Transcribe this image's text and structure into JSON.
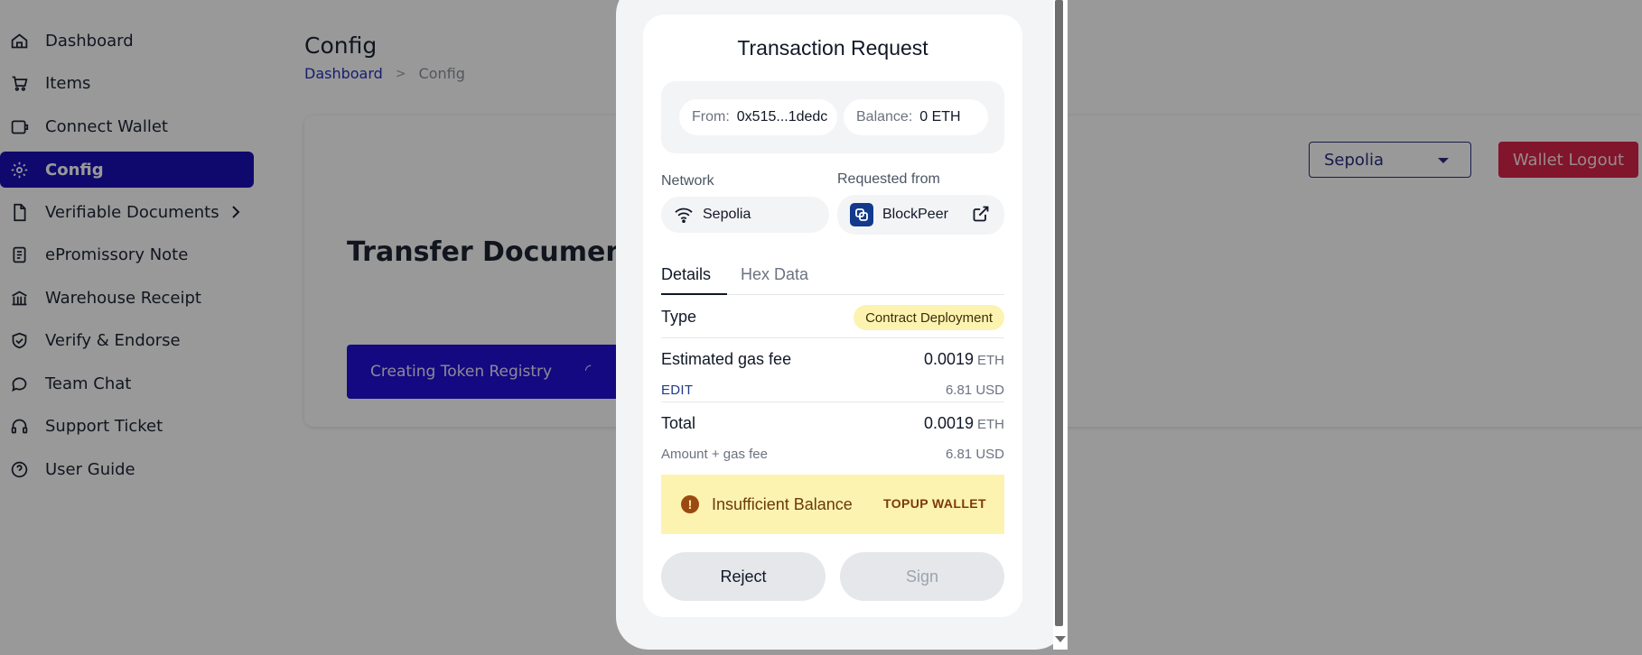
{
  "sidebar": {
    "items": [
      {
        "label": "Dashboard",
        "icon": "home-icon"
      },
      {
        "label": "Items",
        "icon": "cart-icon"
      },
      {
        "label": "Connect Wallet",
        "icon": "wallet-icon"
      },
      {
        "label": "Config",
        "icon": "gear-icon",
        "active": true
      },
      {
        "label": "Verifiable Documents",
        "icon": "document-icon"
      },
      {
        "label": "ePromissory Note",
        "icon": "note-icon"
      },
      {
        "label": "Warehouse Receipt",
        "icon": "warehouse-icon"
      },
      {
        "label": "Verify & Endorse",
        "icon": "shield-check-icon"
      },
      {
        "label": "Team Chat",
        "icon": "chat-icon"
      },
      {
        "label": "Support Ticket",
        "icon": "headset-icon"
      },
      {
        "label": "User Guide",
        "icon": "help-circle-icon"
      }
    ]
  },
  "header": {
    "title": "Config",
    "breadcrumb": {
      "root": "Dashboard",
      "separator": ">",
      "current": "Config"
    }
  },
  "main": {
    "heading": "Transfer Documents",
    "progress_button": "Creating Token Registry",
    "network_select": "Sepolia",
    "logout_button": "Wallet Logout"
  },
  "popup": {
    "title": "Transaction Request",
    "from_label": "From:",
    "from_value": "0x515...1dedc",
    "balance_label": "Balance:",
    "balance_value": "0 ETH",
    "network_label": "Network",
    "network_value": "Sepolia",
    "requested_label": "Requested from",
    "requested_value": "BlockPeer",
    "tabs": [
      "Details",
      "Hex Data"
    ],
    "type_label": "Type",
    "type_value": "Contract Deployment",
    "gas_label": "Estimated gas fee",
    "gas_value": "0.0019",
    "gas_unit": "ETH",
    "gas_usd": "6.81 USD",
    "edit_label": "EDIT",
    "total_label": "Total",
    "total_sub": "Amount + gas fee",
    "total_value": "0.0019",
    "total_unit": "ETH",
    "total_usd": "6.81 USD",
    "warning_text": "Insufficient Balance",
    "topup_label": "TOPUP WALLET",
    "reject_label": "Reject",
    "sign_label": "Sign"
  },
  "colors": {
    "sidebar_active": "#1a0fb7",
    "logout": "#d8234a",
    "warning_bg": "#fdf3b0",
    "badge_bg": "#fdf3b0"
  }
}
